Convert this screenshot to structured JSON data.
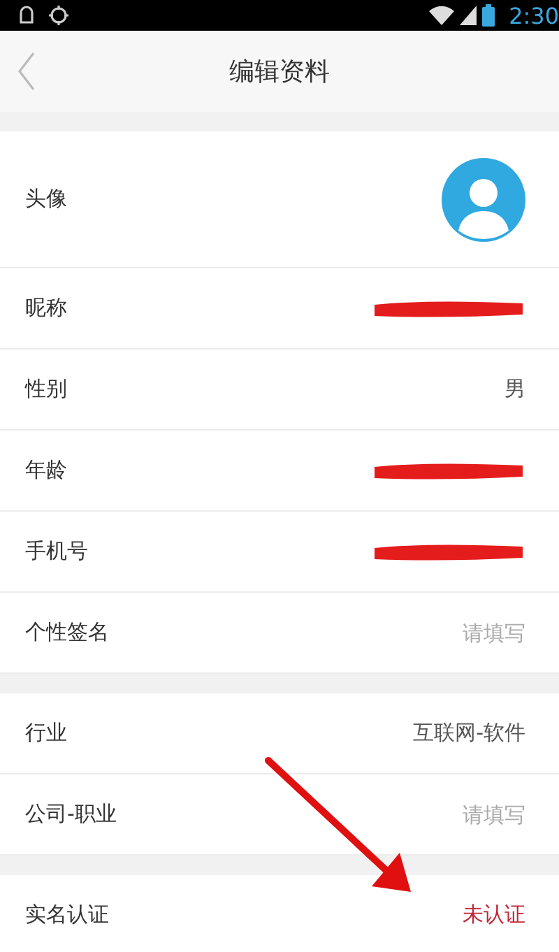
{
  "status_bar": {
    "time": "2:30"
  },
  "header": {
    "title": "编辑资料"
  },
  "sections": [
    {
      "rows": [
        {
          "label": "头像",
          "kind": "avatar"
        },
        {
          "label": "昵称",
          "kind": "redacted"
        },
        {
          "label": "性别",
          "kind": "text",
          "value": "男"
        },
        {
          "label": "年龄",
          "kind": "redacted"
        },
        {
          "label": "手机号",
          "kind": "redacted"
        },
        {
          "label": "个性签名",
          "kind": "text",
          "placeholder": "请填写"
        }
      ]
    },
    {
      "rows": [
        {
          "label": "行业",
          "kind": "text",
          "value": "互联网-软件"
        },
        {
          "label": "公司-职业",
          "kind": "text",
          "placeholder": "请填写"
        }
      ]
    },
    {
      "rows": [
        {
          "label": "实名认证",
          "kind": "status",
          "value": "未认证",
          "verified": false
        }
      ]
    }
  ]
}
